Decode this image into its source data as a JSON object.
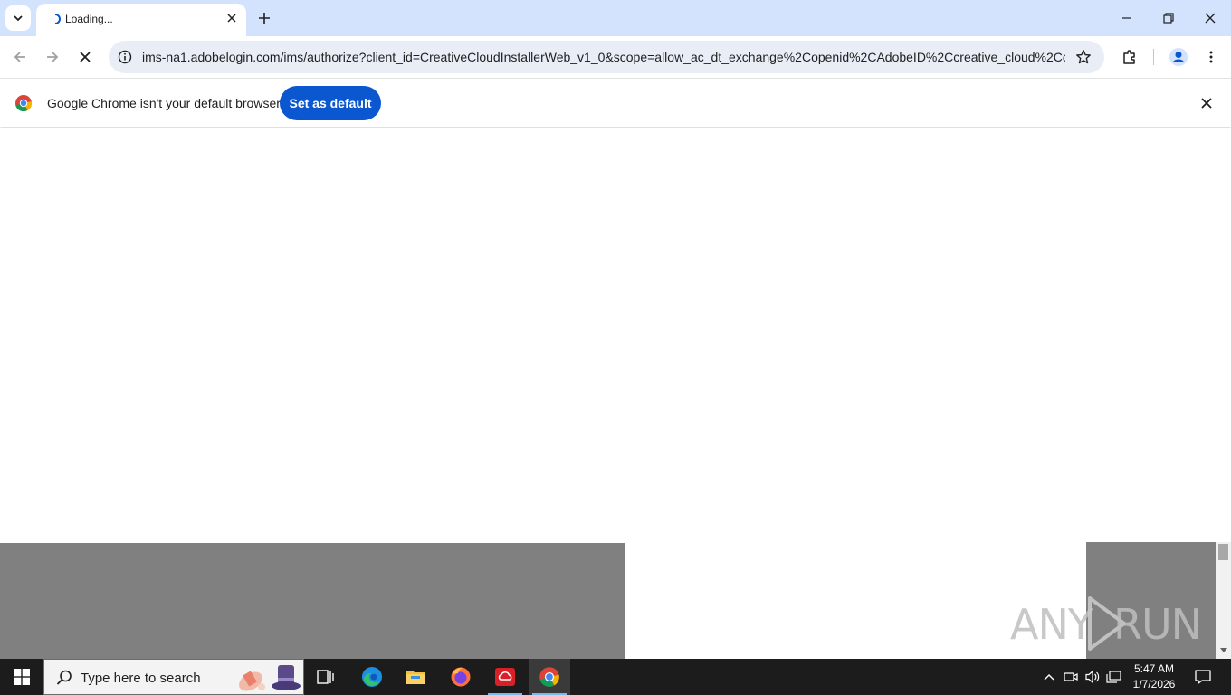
{
  "browser": {
    "tab": {
      "title": "Loading..."
    },
    "address": {
      "url": "ims-na1.adobelogin.com/ims/authorize?client_id=CreativeCloudInstallerWeb_v1_0&scope=allow_ac_dt_exchange%2Copenid%2CAdobeID%2Ccreative_cloud%2Ccr..."
    },
    "infobar": {
      "message": "Google Chrome isn't your default browser",
      "button_label": "Set as default"
    }
  },
  "watermark": {
    "left": "ANY",
    "right": "RUN"
  },
  "taskbar": {
    "search_placeholder": "Type here to search",
    "clock": {
      "time": "5:47 AM",
      "date": "1/7/2026"
    }
  },
  "colors": {
    "tabstrip": "#d3e3fd",
    "omnibox": "#e9eef6",
    "accent": "#0b57d0",
    "overlay": "#808080",
    "taskbar": "#1c1c1c"
  }
}
